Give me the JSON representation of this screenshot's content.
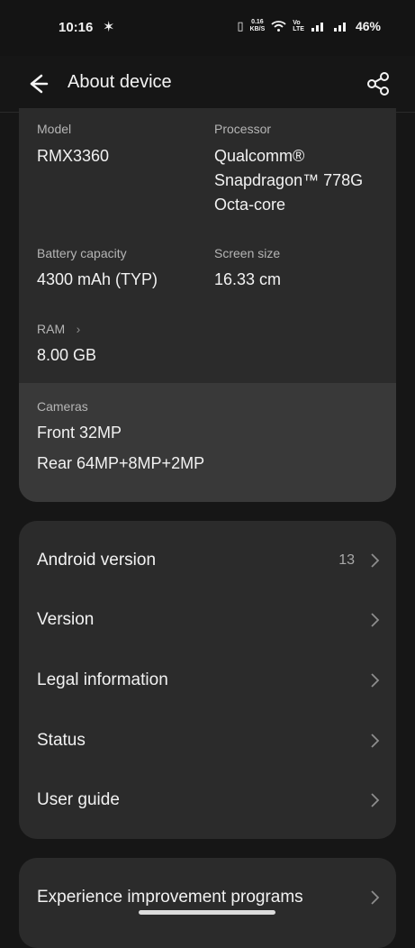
{
  "status_bar": {
    "time": "10:16",
    "left_icon": "✶",
    "speed_value": "0.16",
    "speed_unit": "KB/S",
    "volte": "Vo\nLTE",
    "battery": "46%"
  },
  "appbar": {
    "title": "About device"
  },
  "specs": {
    "model_label": "Model",
    "model_value": "RMX3360",
    "processor_label": "Processor",
    "processor_value": "Qualcomm®\nSnapdragon™ 778G\nOcta-core",
    "battery_label": "Battery capacity",
    "battery_value": "4300 mAh (TYP)",
    "screen_label": "Screen size",
    "screen_value": "16.33 cm",
    "ram_label": "RAM",
    "ram_value": "8.00 GB",
    "cameras_label": "Cameras",
    "front_camera": "Front 32MP",
    "rear_camera": "Rear 64MP+8MP+2MP"
  },
  "menu": {
    "items": [
      {
        "label": "Android version",
        "value": "13"
      },
      {
        "label": "Version",
        "value": ""
      },
      {
        "label": "Legal information",
        "value": ""
      },
      {
        "label": "Status",
        "value": ""
      },
      {
        "label": "User guide",
        "value": ""
      }
    ],
    "experience": "Experience improvement programs"
  }
}
